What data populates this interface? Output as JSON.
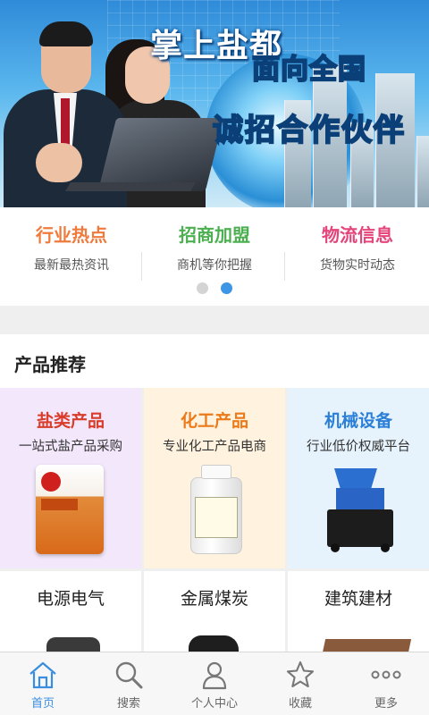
{
  "banner": {
    "title": "掌上盐都",
    "line1": "面向全国",
    "line2": "诚招合作伙伴"
  },
  "quick_links": [
    {
      "title": "行业热点",
      "subtitle": "最新最热资讯",
      "color": "#f07a3c"
    },
    {
      "title": "招商加盟",
      "subtitle": "商机等你把握",
      "color": "#4cb050"
    },
    {
      "title": "物流信息",
      "subtitle": "货物实时动态",
      "color": "#e4457a"
    }
  ],
  "pager": {
    "count": 2,
    "active_index": 1,
    "inactive_color": "#d4d4d4",
    "active_color": "#3d95e6"
  },
  "section": {
    "title": "产品推荐"
  },
  "featured": [
    {
      "title": "盐类产品",
      "subtitle": "一站式盐产品采购",
      "title_color": "#d93c2a",
      "bg": "#f3e8fb",
      "image": "salt-bag"
    },
    {
      "title": "化工产品",
      "subtitle": "专业化工产品电商",
      "title_color": "#ea7a1a",
      "bg": "#fff3df",
      "image": "chemical-bottle"
    },
    {
      "title": "机械设备",
      "subtitle": "行业低价权威平台",
      "title_color": "#2c7fd6",
      "bg": "#e6f3fc",
      "image": "crusher-machine"
    }
  ],
  "categories": [
    {
      "title": "电源电气"
    },
    {
      "title": "金属煤炭"
    },
    {
      "title": "建筑建材"
    }
  ],
  "tabbar": {
    "active_color": "#3a8ee0",
    "items": [
      {
        "label": "首页",
        "icon": "home-icon"
      },
      {
        "label": "搜索",
        "icon": "search-icon"
      },
      {
        "label": "个人中心",
        "icon": "user-icon"
      },
      {
        "label": "收藏",
        "icon": "star-icon"
      },
      {
        "label": "更多",
        "icon": "more-icon"
      }
    ]
  }
}
